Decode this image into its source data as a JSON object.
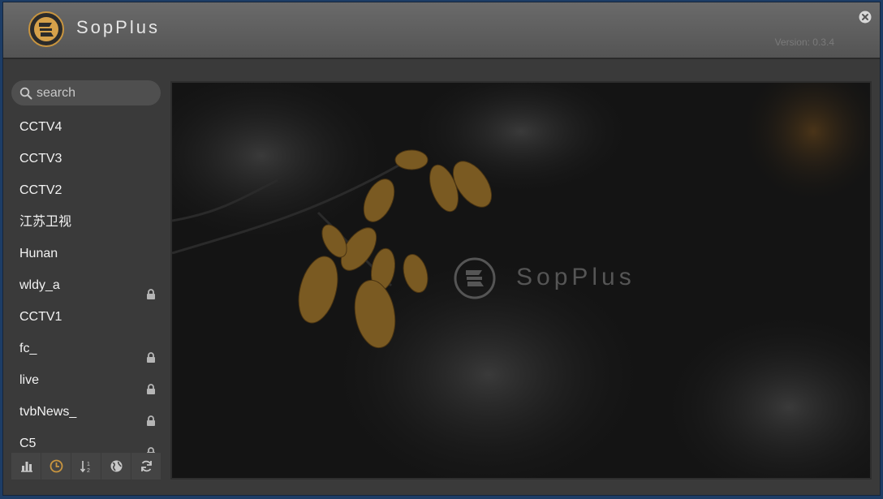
{
  "app": {
    "title": "SopPlus",
    "version": "Version: 0.3.4"
  },
  "search": {
    "placeholder": "search",
    "value": ""
  },
  "channels": [
    {
      "name": "CCTV4",
      "locked": false
    },
    {
      "name": "CCTV3",
      "locked": false
    },
    {
      "name": "CCTV2",
      "locked": false
    },
    {
      "name": "江苏卫视",
      "locked": false
    },
    {
      "name": "Hunan",
      "locked": false
    },
    {
      "name": "wldy_a",
      "locked": true
    },
    {
      "name": "CCTV1",
      "locked": false
    },
    {
      "name": "fc_",
      "locked": true
    },
    {
      "name": "live",
      "locked": true
    },
    {
      "name": "tvbNews_",
      "locked": true
    },
    {
      "name": "C5",
      "locked": true
    }
  ],
  "toolbar": [
    {
      "icon": "bar-chart-icon",
      "active": false
    },
    {
      "icon": "clock-icon",
      "active": true
    },
    {
      "icon": "sort-numeric-icon",
      "active": false
    },
    {
      "icon": "globe-icon",
      "active": false
    },
    {
      "icon": "refresh-icon",
      "active": false
    }
  ],
  "player": {
    "brand": "SopPlus"
  },
  "colors": {
    "accent": "#c9953f",
    "titlebar": "#5f5f5f",
    "panel": "#3a3a3a",
    "text": "#f2f2f2",
    "lock": "#b5b5b5"
  }
}
